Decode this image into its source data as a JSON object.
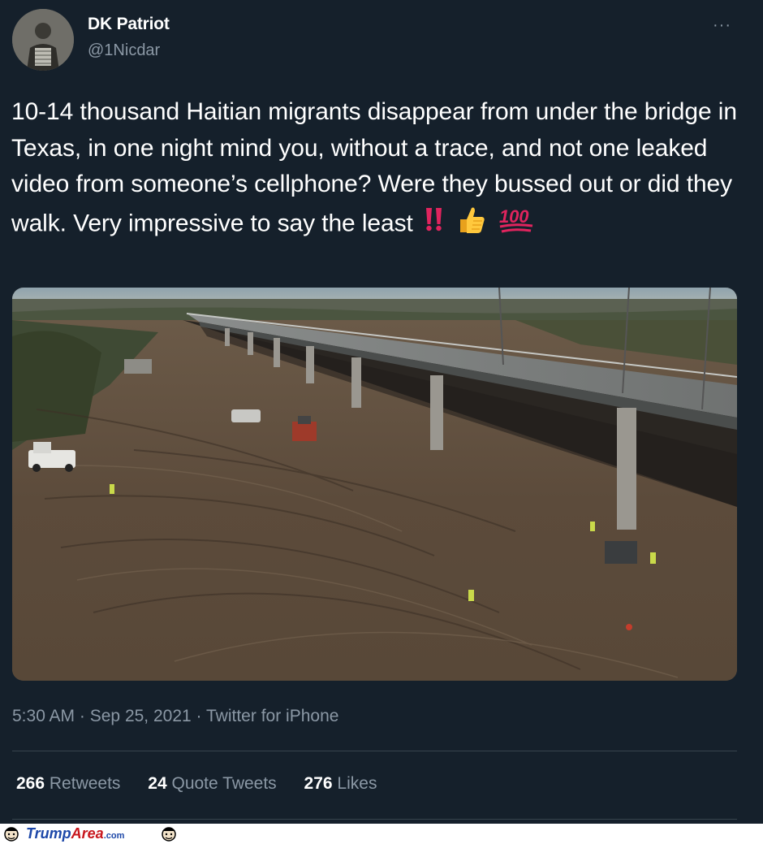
{
  "author": {
    "name": "DK Patriot",
    "handle": "@1Nicdar",
    "avatar_icon": "user-avatar",
    "more_icon": "more-options-icon",
    "more_label": "···"
  },
  "tweet": {
    "text": "10-14 thousand Haitian migrants disappear from under the bridge in Texas, in one night mind you, without a trace, and not one leaked video from someone’s cellphone? Were they bussed out or did they walk. Very impressive to say the least",
    "emojis": [
      "‼️",
      "👍",
      "💯"
    ],
    "photo_description_icon": "bridge-photo"
  },
  "meta": {
    "time": "5:30 AM",
    "separator": "·",
    "date": "Sep 25, 2021",
    "source": "Twitter for iPhone"
  },
  "stats": {
    "retweets_count": "266",
    "retweets_label": "Retweets",
    "quotes_count": "24",
    "quotes_label": "Quote Tweets",
    "likes_count": "276",
    "likes_label": "Likes"
  },
  "watermark": {
    "part1": "Trump",
    "part2": "Area",
    "part3": ".com"
  },
  "colors": {
    "background": "#15202b",
    "secondary_text": "#8b98a5",
    "divider": "#38444d"
  }
}
